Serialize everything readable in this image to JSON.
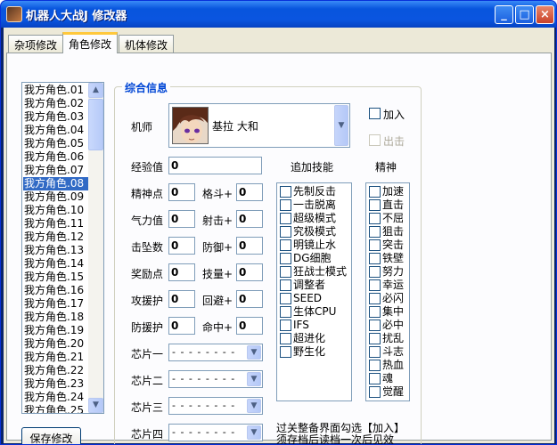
{
  "window": {
    "title": "机器人大战J  修改器"
  },
  "titlebar_buttons": {
    "minimize": "_",
    "maximize": "□",
    "close": "×"
  },
  "tabs": [
    {
      "label": "杂项修改",
      "active": false
    },
    {
      "label": "角色修改",
      "active": true
    },
    {
      "label": "机体修改",
      "active": false
    }
  ],
  "character_list": {
    "items": [
      "我方角色.01",
      "我方角色.02",
      "我方角色.03",
      "我方角色.04",
      "我方角色.05",
      "我方角色.06",
      "我方角色.07",
      "我方角色.08",
      "我方角色.09",
      "我方角色.10",
      "我方角色.11",
      "我方角色.12",
      "我方角色.13",
      "我方角色.14",
      "我方角色.15",
      "我方角色.16",
      "我方角色.17",
      "我方角色.18",
      "我方角色.19",
      "我方角色.20",
      "我方角色.21",
      "我方角色.22",
      "我方角色.23",
      "我方角色.24",
      "我方角色.25"
    ],
    "selected": "我方角色.08",
    "scroll_up": "▲",
    "scroll_down": "▼"
  },
  "save_button": "保存修改",
  "info": {
    "title": "综合信息",
    "pilot_label": "机师",
    "pilot_name": "基拉  大和",
    "join_label": "加入",
    "join_checked": false,
    "leave_label": "出击",
    "leave_disabled": true,
    "dropdown_arrow": "▼"
  },
  "stats_left": [
    {
      "label": "经验值",
      "value": "0"
    },
    {
      "label": "精神点",
      "value": "0"
    },
    {
      "label": "气力值",
      "value": "0"
    },
    {
      "label": "击坠数",
      "value": "0"
    },
    {
      "label": "奖励点",
      "value": "0"
    },
    {
      "label": "攻援护",
      "value": "0"
    },
    {
      "label": "防援护",
      "value": "0"
    }
  ],
  "stats_right": [
    {
      "label": "格斗+",
      "value": "0"
    },
    {
      "label": "射击+",
      "value": "0"
    },
    {
      "label": "防御+",
      "value": "0"
    },
    {
      "label": "技量+",
      "value": "0"
    },
    {
      "label": "回避+",
      "value": "0"
    },
    {
      "label": "命中+",
      "value": "0"
    }
  ],
  "chips": [
    {
      "label": "芯片一",
      "value": "- - - - - - - -"
    },
    {
      "label": "芯片二",
      "value": "- - - - - - - -"
    },
    {
      "label": "芯片三",
      "value": "- - - - - - - -"
    },
    {
      "label": "芯片四",
      "value": "- - - - - - - -"
    }
  ],
  "skills": {
    "title": "追加技能",
    "items": [
      "先制反击",
      "一击脱离",
      "超级模式",
      "究极模式",
      "明镜止水",
      "DG细胞",
      "狂战士模式",
      "调整者",
      "SEED",
      "生体CPU",
      "IFS",
      "超进化",
      "野生化"
    ]
  },
  "spirits": {
    "title": "精神",
    "items": [
      "加速",
      "直击",
      "不屈",
      "狙击",
      "突击",
      "铁壁",
      "努力",
      "幸运",
      "必闪",
      "集中",
      "必中",
      "扰乱",
      "斗志",
      "热血",
      "魂",
      "觉醒"
    ]
  },
  "notes": [
    "过关整备界面勾选【加入】",
    "须存档后读档一次后见效"
  ]
}
